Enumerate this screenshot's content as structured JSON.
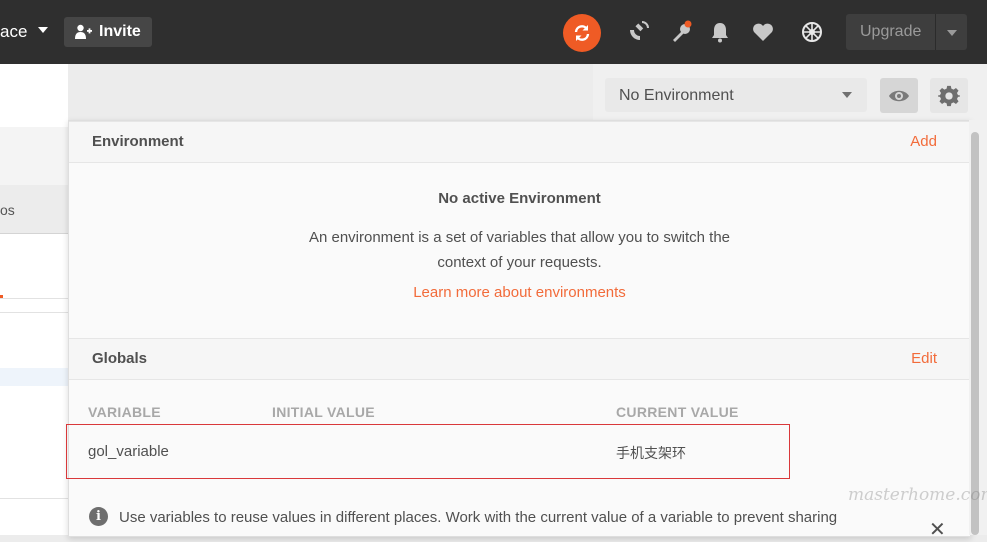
{
  "topbar": {
    "workspace_label": "ace",
    "invite_label": "Invite",
    "upgrade_label": "Upgrade",
    "bg_color": "#2f2f2f",
    "sync_color": "#ef5b25",
    "icons": [
      "sync-icon",
      "satellite-icon",
      "notification-wrench-icon",
      "bell-icon",
      "heart-icon",
      "settings-wheel-icon"
    ]
  },
  "left_panel": {
    "tab_fragment": "os"
  },
  "environment_selector": {
    "selected": "No Environment"
  },
  "popover": {
    "environment_section": {
      "title": "Environment",
      "action": "Add",
      "empty_title": "No active Environment",
      "description_line1": "An environment is a set of variables that allow you to switch the",
      "description_line2": "context of your requests.",
      "learn_more": "Learn more about environments"
    },
    "globals_section": {
      "title": "Globals",
      "action": "Edit",
      "columns": [
        "VARIABLE",
        "INITIAL VALUE",
        "CURRENT VALUE"
      ],
      "rows": [
        {
          "variable": "gol_variable",
          "initial_value": "",
          "current_value": "手机支架环"
        }
      ]
    },
    "info_text": "Use variables to reuse values in different places. Work with the current value of a variable to prevent sharing",
    "accent_color": "#f26b3a"
  },
  "watermark": "masterhome.com"
}
